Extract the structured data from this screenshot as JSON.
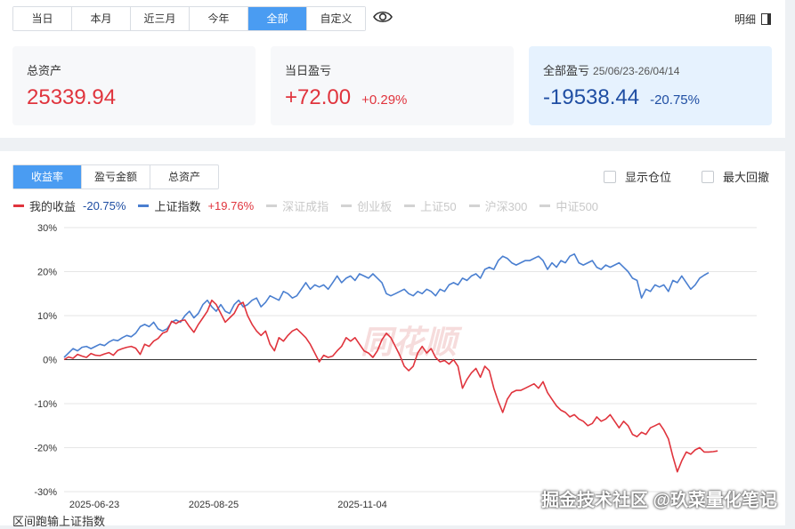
{
  "range_tabs": [
    "当日",
    "本月",
    "近三月",
    "今年",
    "全部",
    "自定义"
  ],
  "active_range": 4,
  "detail_label": "明细",
  "cards": [
    {
      "label": "总资产",
      "sub": "",
      "value": "25339.94",
      "pct": ""
    },
    {
      "label": "当日盈亏",
      "sub": "",
      "value": "+72.00",
      "pct": "+0.29%"
    },
    {
      "label": "全部盈亏",
      "sub": "25/06/23-26/04/14",
      "value": "-19538.44",
      "pct": "-20.75%"
    }
  ],
  "chart_tabs": [
    "收益率",
    "盈亏金额",
    "总资产"
  ],
  "active_chart_tab": 0,
  "checkboxes": [
    "显示仓位",
    "最大回撤"
  ],
  "legend": [
    {
      "name": "我的收益",
      "value": "-20.75%",
      "color": "#e0343d",
      "value_color": "#1f4ea3",
      "active": true
    },
    {
      "name": "上证指数",
      "value": "+19.76%",
      "color": "#4a7fd0",
      "value_color": "#e0343d",
      "active": true
    },
    {
      "name": "深证成指",
      "value": "",
      "color": "#d3d3d3",
      "active": false
    },
    {
      "name": "创业板",
      "value": "",
      "color": "#d3d3d3",
      "active": false
    },
    {
      "name": "上证50",
      "value": "",
      "color": "#d3d3d3",
      "active": false
    },
    {
      "name": "沪深300",
      "value": "",
      "color": "#d3d3d3",
      "active": false
    },
    {
      "name": "中证500",
      "value": "",
      "color": "#d3d3d3",
      "active": false
    }
  ],
  "watermark_logo": "同花顺",
  "watermark_text": "掘金技术社区 @玖菜量化笔记",
  "footer_text": "区间跑输上证指数",
  "chart_data": {
    "type": "line",
    "ylim": [
      -30,
      30
    ],
    "yticks": [
      "30%",
      "20%",
      "10%",
      "0%",
      "-10%",
      "-20%",
      "-30%"
    ],
    "xticks": [
      "2025-06-23",
      "2025-08-25",
      "2025-11-04"
    ],
    "n": 145,
    "series": [
      {
        "name": "我的收益",
        "color": "#e0343d",
        "values": [
          0,
          0.6,
          0.3,
          1.2,
          0.8,
          0.5,
          1.4,
          1.0,
          0.9,
          1.3,
          1.6,
          1.0,
          2.1,
          2.5,
          2.8,
          3.0,
          2.6,
          1.2,
          3.5,
          3.0,
          4.2,
          4.8,
          6.0,
          6.4,
          8.7,
          8.2,
          8.8,
          9.0,
          7.5,
          6.2,
          8.0,
          9.5,
          11.0,
          13.5,
          12.5,
          10.5,
          8.5,
          9.5,
          10.5,
          12.5,
          13.0,
          10.0,
          8.0,
          6.5,
          5.5,
          6.5,
          3.5,
          2.0,
          5.0,
          4.2,
          5.5,
          6.5,
          7.0,
          6.0,
          5.0,
          3.5,
          1.5,
          -0.5,
          1.0,
          0.5,
          0.8,
          2.0,
          3.0,
          5.0,
          4.2,
          5.0,
          3.5,
          2.0,
          1.5,
          0.5,
          2.0,
          4.5,
          6.0,
          5.0,
          3.0,
          1.0,
          -1.5,
          -2.5,
          -1.5,
          1.5,
          3.0,
          1.5,
          2.5,
          0.5,
          -0.5,
          -0.2,
          -1.0,
          0,
          -1.5,
          -6.5,
          -4.5,
          -3.0,
          -2.0,
          -4.0,
          -1.5,
          -2.5,
          -6.5,
          -9.5,
          -12.0,
          -9.0,
          -7.5,
          -7.0,
          -7.0,
          -6.5,
          -6.0,
          -5.5,
          -6.5,
          -5.0,
          -7.5,
          -9.0,
          -10.5,
          -11.5,
          -12.0,
          -13.0,
          -12.5,
          -13.5,
          -14.0,
          -15.0,
          -14.5,
          -13.0,
          -14.0,
          -13.5,
          -12.5,
          -14.0,
          -15.5,
          -14.0,
          -15.0,
          -17.0,
          -17.5,
          -16.5,
          -17.0,
          -15.5,
          -15.0,
          -14.5,
          -16.0,
          -18.0,
          -22.0,
          -25.5,
          -23.0,
          -21.0,
          -21.5,
          -20.5,
          -20.0,
          -21.0,
          -21.0,
          -20.9,
          -20.75
        ]
      },
      {
        "name": "上证指数",
        "color": "#4a7fd0",
        "values": [
          0.5,
          1.5,
          2.5,
          2.0,
          2.8,
          3.0,
          2.5,
          3.0,
          3.5,
          3.2,
          4.0,
          4.5,
          4.3,
          5.0,
          5.5,
          5.2,
          6.0,
          7.5,
          8.0,
          7.5,
          8.5,
          7.0,
          6.5,
          7.0,
          8.5,
          9.0,
          8.5,
          10.0,
          11.0,
          9.5,
          10.5,
          12.5,
          13.5,
          12.0,
          11.0,
          12.5,
          11.0,
          10.5,
          12.5,
          13.5,
          12.0,
          12.5,
          13.5,
          14.0,
          12.0,
          13.0,
          14.5,
          14.0,
          13.5,
          15.5,
          15.0,
          14.0,
          14.5,
          16.0,
          17.5,
          16.0,
          17.0,
          16.5,
          17.0,
          16.0,
          17.5,
          19.0,
          17.5,
          18.5,
          19.0,
          18.0,
          19.5,
          19.0,
          18.5,
          19.5,
          18.5,
          17.5,
          15.0,
          14.5,
          15.0,
          15.5,
          16.0,
          15.0,
          14.5,
          15.5,
          15.0,
          16.0,
          15.5,
          14.5,
          16.0,
          15.5,
          17.0,
          17.5,
          17.0,
          18.5,
          18.0,
          19.0,
          19.5,
          18.5,
          20.5,
          21.0,
          20.5,
          22.5,
          23.5,
          23.0,
          22.0,
          21.5,
          22.0,
          22.5,
          22.5,
          23.0,
          23.5,
          22.5,
          20.5,
          22.0,
          21.0,
          22.5,
          22.0,
          23.5,
          24.0,
          22.0,
          21.5,
          22.0,
          22.5,
          21.0,
          20.5,
          21.5,
          21.0,
          21.5,
          22.0,
          21.0,
          20.0,
          18.5,
          18.0,
          14.0,
          16.0,
          15.5,
          17.0,
          16.5,
          17.0,
          15.5,
          18.0,
          17.5,
          19.0,
          17.5,
          16.0,
          17.0,
          18.5,
          19.2,
          19.76
        ]
      }
    ]
  }
}
